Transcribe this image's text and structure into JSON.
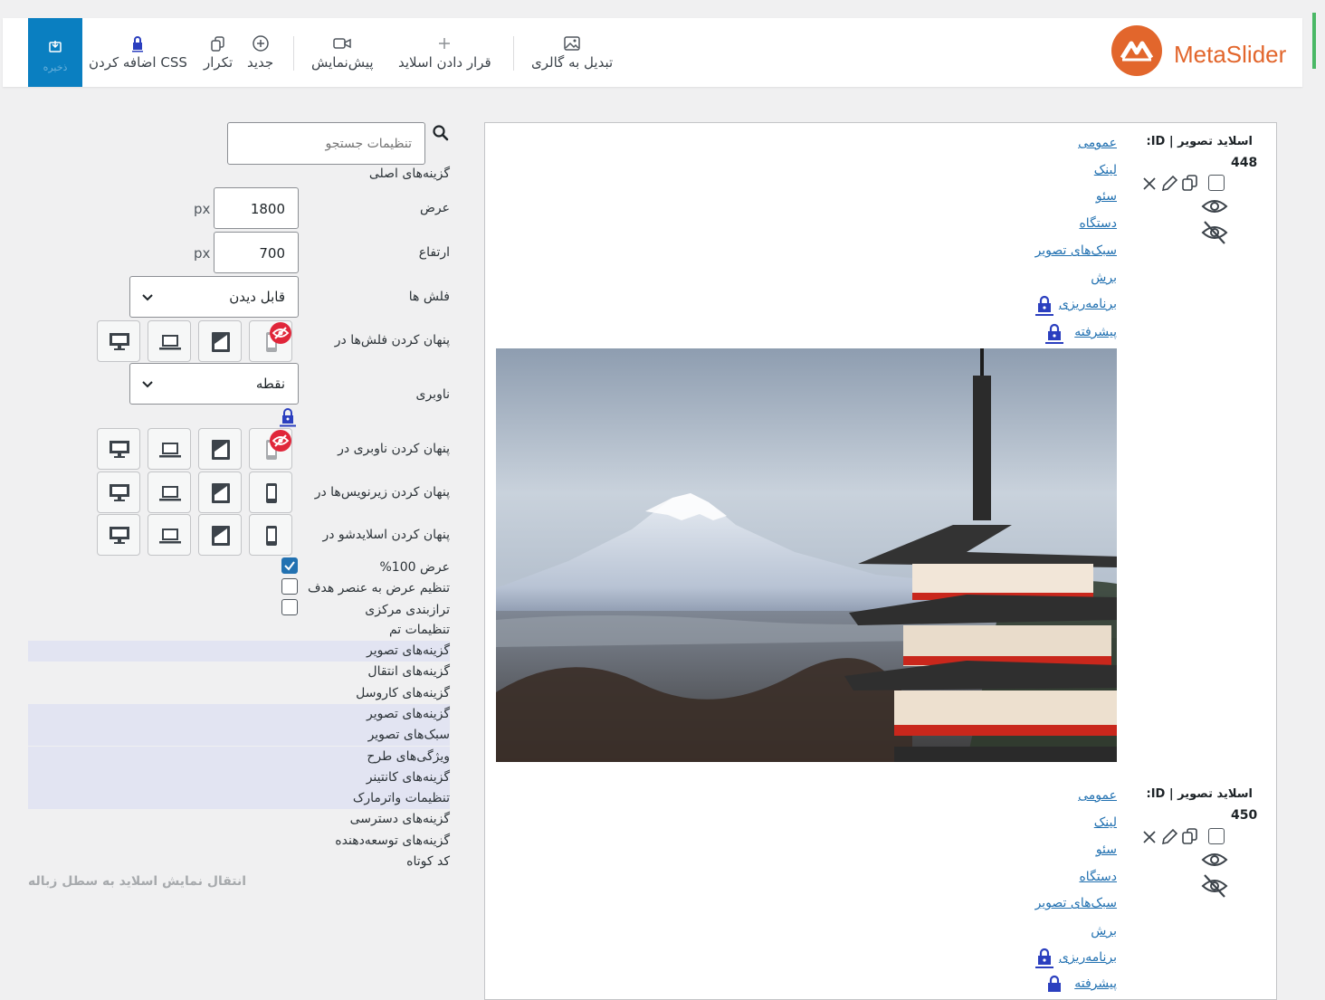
{
  "toolbar": {
    "save_label": "ذخیره",
    "add_css_label": "اضافه کردن CSS",
    "duplicate_label": "تکرار",
    "new_label": "جدید",
    "preview_label": "پیش‌نمایش",
    "add_slide_label": "قرار دادن اسلاید",
    "convert_gallery_label": "تبدیل به گالری",
    "logo_text": "MetaSlider"
  },
  "settings": {
    "search_placeholder": "تنظیمات جستجو",
    "main_options_heading": "گزینه‌های اصلی",
    "width_label": "عرض",
    "width_value": "1800",
    "height_label": "ارتفاع",
    "height_value": "700",
    "px_unit": "px",
    "arrows_label": "فلش ها",
    "arrows_value": "قابل دیدن",
    "hide_arrows_label": "پنهان کردن فلش‌ها در",
    "navigation_label": "ناوبری",
    "navigation_value": "نقطه",
    "hide_navigation_label": "پنهان کردن ناوبری در",
    "hide_captions_label": "پنهان کردن زیرنویس‌ها در",
    "hide_slideshow_label": "پنهان کردن اسلایدشو در",
    "full_width_label": "عرض 100%",
    "full_width_checked": true,
    "adapt_width_label": "تنظیم عرض به عنصر هدف",
    "adapt_width_checked": false,
    "center_label": "ترازبندی مرکزی",
    "center_checked": false,
    "theme_settings_label": "تنظیمات تم",
    "accordion": [
      {
        "label": "گزینه‌های تصویر",
        "highlight": true
      },
      {
        "label": "گزینه‌های انتقال",
        "highlight": false
      },
      {
        "label": "گزینه‌های کاروسل",
        "highlight": false
      },
      {
        "label": "گزینه‌های تصویر",
        "highlight": true
      },
      {
        "label": "سبک‌های تصویر",
        "highlight": true
      },
      {
        "label": "ویژگی‌های طرح",
        "highlight": true
      },
      {
        "label": "گزینه‌های کانتینر",
        "highlight": true
      },
      {
        "label": "تنظیمات واترمارک",
        "highlight": true
      },
      {
        "label": "گزینه‌های دسترسی",
        "highlight": false
      },
      {
        "label": "گزینه‌های توسعه‌دهنده",
        "highlight": false
      },
      {
        "label": "کد کوتاه",
        "highlight": false
      }
    ],
    "trash_link": "انتقال نمایش اسلاید به سطل زباله"
  },
  "slides": [
    {
      "type_label": "اسلاید تصویر | ID:",
      "id": "448",
      "tabs": [
        "عمومی",
        "لینک",
        "سئو",
        "دستگاه",
        "سبک‌های تصویر",
        "برش",
        "برنامه‌ریزی",
        "پیشرفته"
      ]
    },
    {
      "type_label": "اسلاید تصویر | ID:",
      "id": "450",
      "tabs": [
        "عمومی",
        "لینک",
        "سئو",
        "دستگاه",
        "سبک‌های تصویر",
        "برش",
        "برنامه‌ریزی",
        "پیشرفته"
      ]
    }
  ],
  "colors": {
    "accent": "#2271b1",
    "brand": "#e2662c",
    "save": "#0a7fc1",
    "hidden_badge": "#e0263a"
  },
  "icons": [
    "save-icon",
    "lock-icon",
    "copy-icon",
    "plus-circle-icon",
    "video-icon",
    "plus-icon",
    "image-icon",
    "search-icon",
    "chevron-down-icon",
    "desktop-icon",
    "laptop-icon",
    "tablet-icon",
    "mobile-icon",
    "eye-off-icon",
    "close-icon",
    "pencil-icon",
    "eye-icon"
  ]
}
